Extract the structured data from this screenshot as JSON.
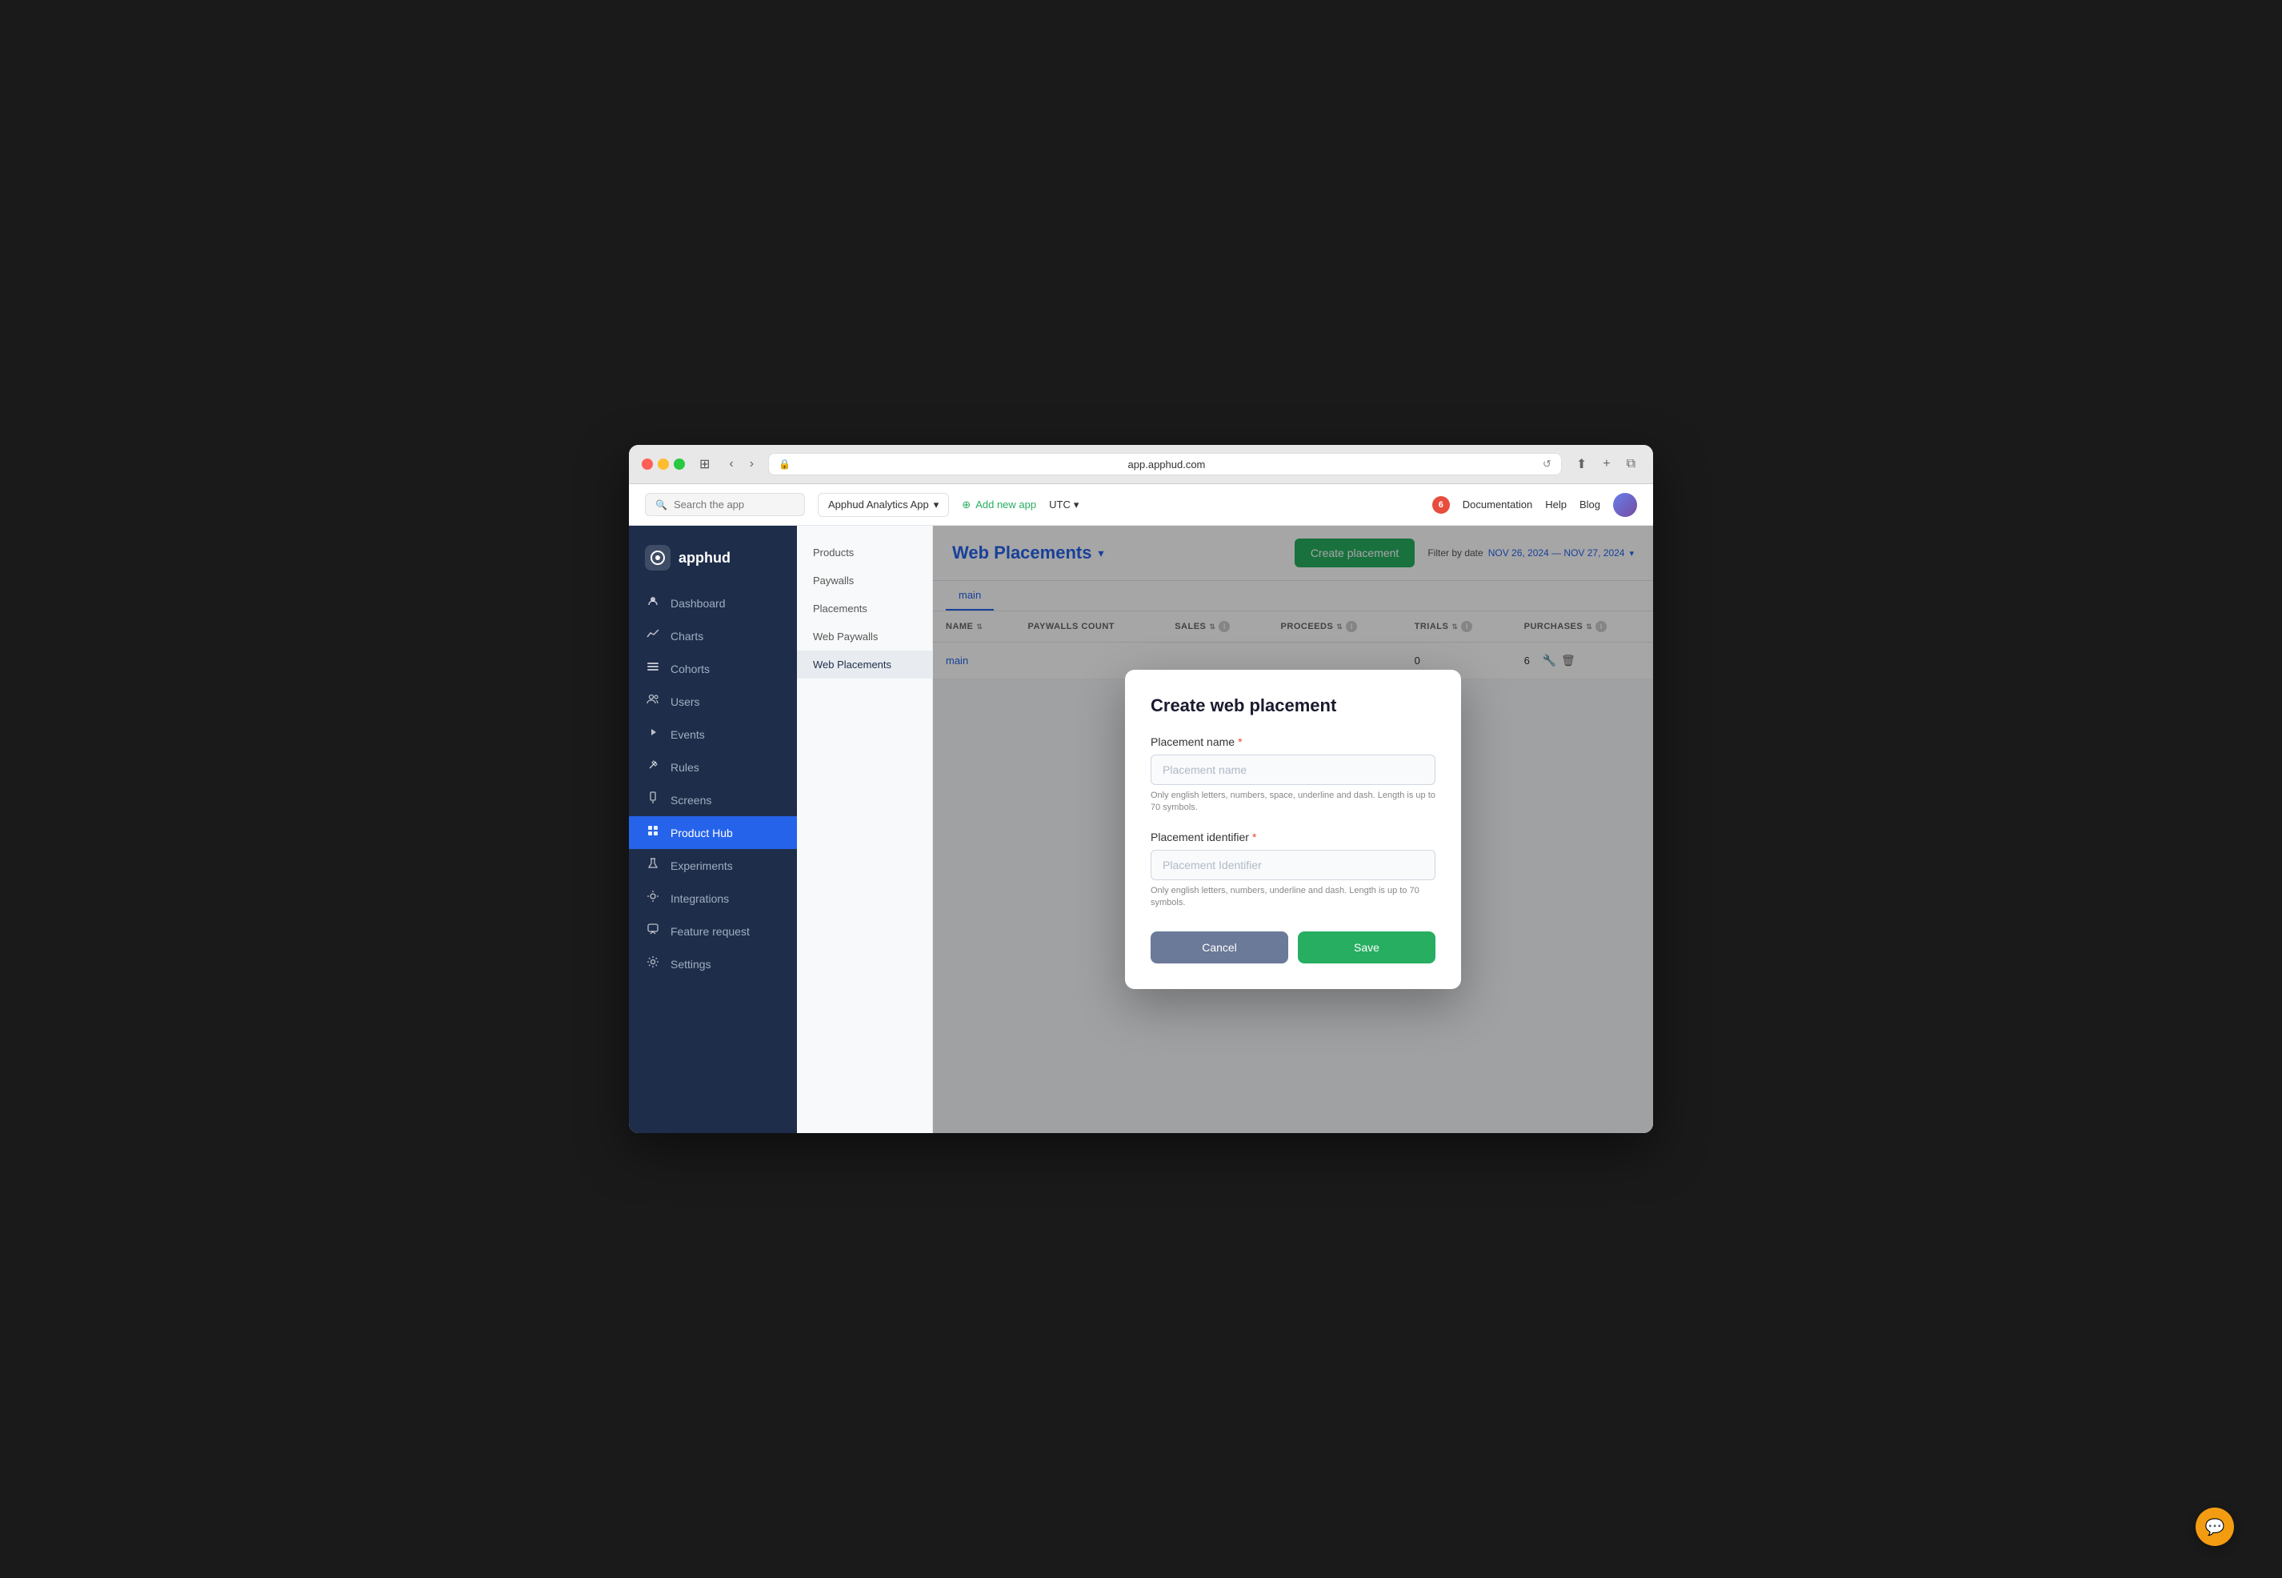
{
  "browser": {
    "url": "app.apphud.com"
  },
  "topnav": {
    "search_placeholder": "Search the app",
    "app_name": "Apphud Analytics App",
    "add_app": "Add new app",
    "timezone": "UTC",
    "notif_count": "6",
    "doc_link": "Documentation",
    "help_link": "Help",
    "blog_link": "Blog"
  },
  "sidebar": {
    "logo": "apphud",
    "items": [
      {
        "id": "dashboard",
        "label": "Dashboard",
        "icon": "👤"
      },
      {
        "id": "charts",
        "label": "Charts",
        "icon": "📈"
      },
      {
        "id": "cohorts",
        "label": "Cohorts",
        "icon": "≡"
      },
      {
        "id": "users",
        "label": "Users",
        "icon": "👥"
      },
      {
        "id": "events",
        "label": "Events",
        "icon": "↩"
      },
      {
        "id": "rules",
        "label": "Rules",
        "icon": "✂"
      },
      {
        "id": "screens",
        "label": "Screens",
        "icon": "📱"
      },
      {
        "id": "product-hub",
        "label": "Product Hub",
        "icon": "🧩"
      },
      {
        "id": "experiments",
        "label": "Experiments",
        "icon": "🧪"
      },
      {
        "id": "integrations",
        "label": "Integrations",
        "icon": "⚙"
      },
      {
        "id": "feature-request",
        "label": "Feature request",
        "icon": "💬"
      },
      {
        "id": "settings",
        "label": "Settings",
        "icon": "⚙"
      }
    ]
  },
  "secondary_sidebar": {
    "items": [
      {
        "id": "products",
        "label": "Products"
      },
      {
        "id": "paywalls",
        "label": "Paywalls"
      },
      {
        "id": "placements",
        "label": "Placements"
      },
      {
        "id": "web-paywalls",
        "label": "Web Paywalls"
      },
      {
        "id": "web-placements",
        "label": "Web Placements"
      }
    ]
  },
  "page": {
    "title": "Web Placements",
    "create_btn": "Create placement",
    "filter_label": "Filter by date",
    "date_range": "NOV 26, 2024 — NOV 27, 2024"
  },
  "tabs": [
    {
      "id": "main",
      "label": "main",
      "active": true
    }
  ],
  "table": {
    "columns": [
      {
        "id": "name",
        "label": "NAME"
      },
      {
        "id": "paywalls_count",
        "label": "PAYWALLS COUNT"
      },
      {
        "id": "sales",
        "label": "SALES"
      },
      {
        "id": "proceeds",
        "label": "PROCEEDS"
      },
      {
        "id": "trials",
        "label": "TRIALS"
      },
      {
        "id": "purchases",
        "label": "PURCHASES"
      }
    ],
    "rows": [
      {
        "name": "main",
        "paywalls_count": "",
        "sales": "",
        "proceeds": "",
        "trials": "0",
        "purchases": "6"
      }
    ]
  },
  "modal": {
    "title": "Create web placement",
    "placement_name_label": "Placement name",
    "placement_name_placeholder": "Placement name",
    "placement_name_hint": "Only english letters, numbers, space, underline and dash. Length is up to 70 symbols.",
    "placement_id_label": "Placement identifier",
    "placement_id_placeholder": "Placement Identifier",
    "placement_id_hint": "Only english letters, numbers, underline and dash. Length is up to 70 symbols.",
    "cancel_btn": "Cancel",
    "save_btn": "Save"
  }
}
